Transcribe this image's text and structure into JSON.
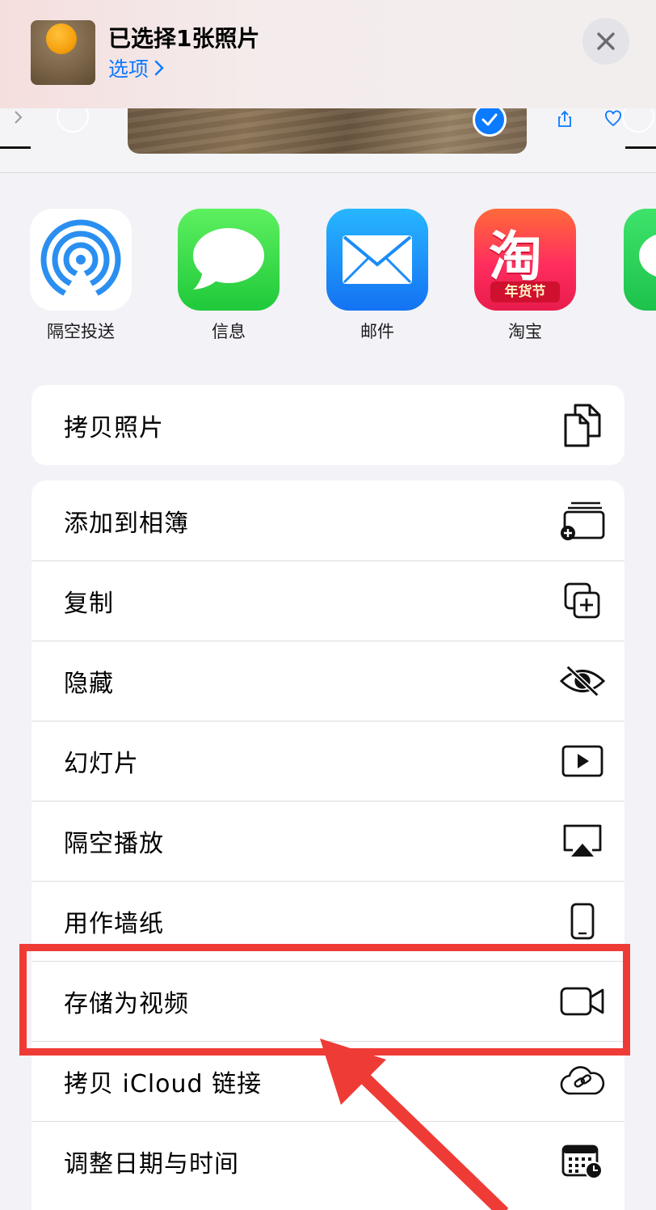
{
  "header": {
    "title": "已选择1张照片",
    "options_label": "选项"
  },
  "share_apps": [
    {
      "label": "隔空投送",
      "icon": "airdrop-icon"
    },
    {
      "label": "信息",
      "icon": "messages-icon"
    },
    {
      "label": "邮件",
      "icon": "mail-icon"
    },
    {
      "label": "淘宝",
      "icon": "taobao-icon",
      "icon_text": "淘",
      "badge_text": "年货节"
    },
    {
      "label": "",
      "icon": "wechat-icon"
    }
  ],
  "actions_primary": [
    {
      "label": "拷贝照片",
      "icon": "copy-photo-icon"
    }
  ],
  "actions_secondary": [
    {
      "label": "添加到相簿",
      "icon": "add-to-album-icon"
    },
    {
      "label": "复制",
      "icon": "duplicate-icon"
    },
    {
      "label": "隐藏",
      "icon": "hide-eye-icon"
    },
    {
      "label": "幻灯片",
      "icon": "slideshow-icon"
    },
    {
      "label": "隔空播放",
      "icon": "airplay-icon"
    },
    {
      "label": "用作墙纸",
      "icon": "wallpaper-phone-icon"
    },
    {
      "label": "存储为视频",
      "icon": "video-camera-icon"
    },
    {
      "label": "拷贝 iCloud 链接",
      "icon": "icloud-link-icon"
    },
    {
      "label": "调整日期与时间",
      "icon": "calendar-clock-icon"
    }
  ],
  "colors": {
    "accent": "#0a7aff",
    "annotation": "#ef3b36",
    "sheet_background": "#f2f2f7"
  }
}
